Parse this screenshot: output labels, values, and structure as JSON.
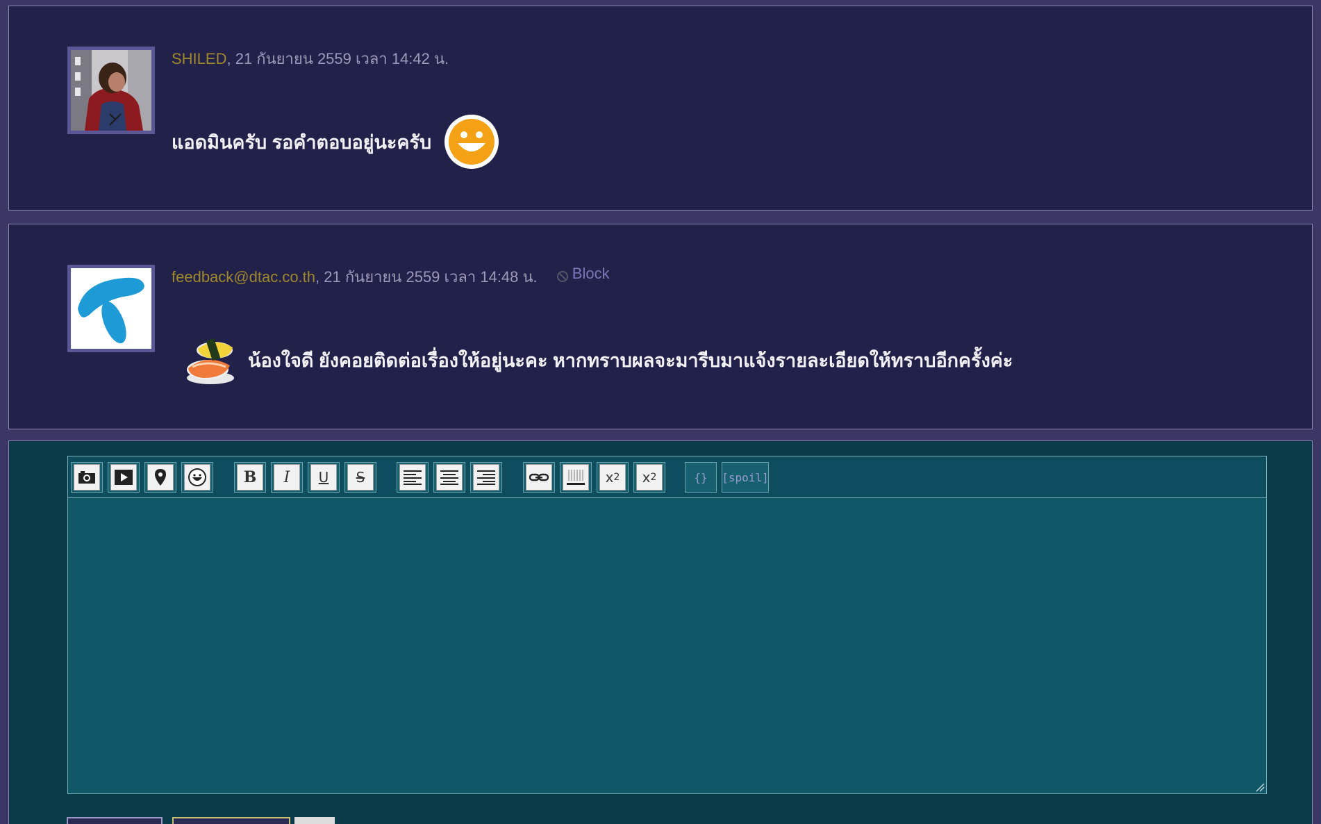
{
  "comments": [
    {
      "author": "SHILED",
      "separator": ", ",
      "timestamp": "21 กันยายน 2559 เวลา 14:42 น.",
      "message": "แอดมินครับ รอคำตอบอยู่นะครับ",
      "avatar_icon": "spiderman-avatar-icon",
      "emoji": "grinning-face-icon"
    },
    {
      "author": "feedback@dtac.co.th",
      "separator": ", ",
      "timestamp": "21 กันยายน 2559 เวลา 14:48 น.",
      "block_label": "Block",
      "message": "น้องใจดี  ยังคอยติดต่อเรื่องให้อยู่นะคะ  หากทราบผลจะมารีบมาแจ้งรายละเอียดให้ทราบอีกครั้งค่ะ",
      "avatar_icon": "dtac-logo-icon",
      "emoji": "sushi-icon"
    }
  ],
  "toolbar": {
    "bold": "B",
    "italic": "I",
    "underline": "U",
    "strike": "S",
    "superscript_base": "x",
    "superscript_exp": "2",
    "subscript_base": "x",
    "subscript_exp": "2",
    "code": "{}",
    "spoil": "[spoil]"
  },
  "colors": {
    "page_bg": "#3b3764",
    "comment_bg": "#22214a",
    "author": "#a0882c",
    "reply_bg": "#0b3a48",
    "editor_bg": "#0f5868"
  }
}
